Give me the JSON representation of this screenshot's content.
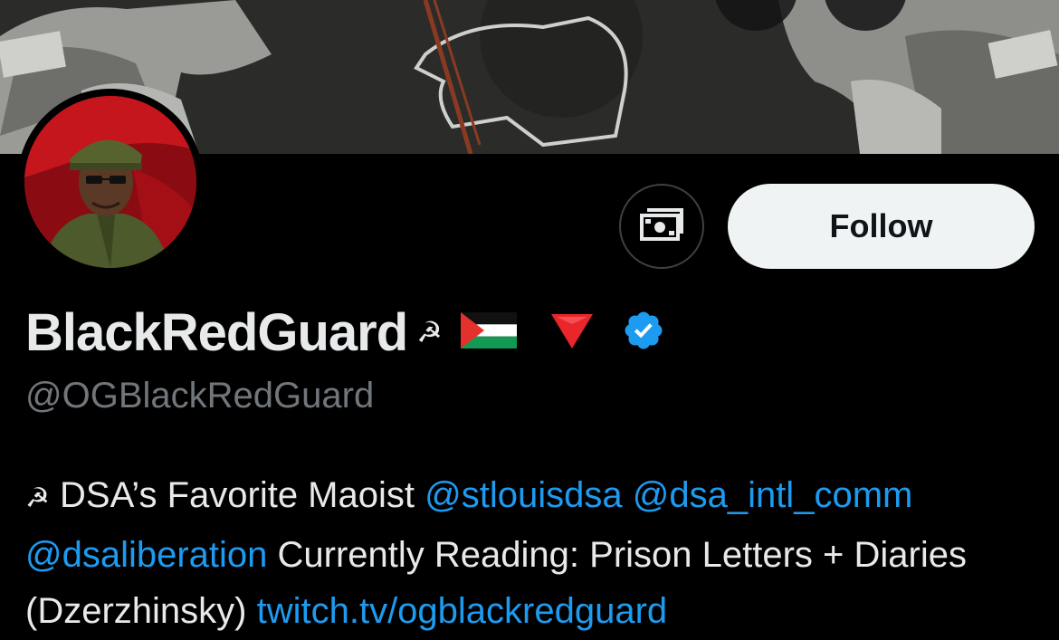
{
  "profile": {
    "display_name": "BlackRedGuard",
    "name_emojis": [
      "hammer-and-sickle",
      "palestine-flag",
      "red-down-triangle"
    ],
    "name_hs_glyph": "☭",
    "handle": "@OGBlackRedGuard",
    "verified": true
  },
  "actions": {
    "follow_label": "Follow",
    "tip_icon": "money-icon"
  },
  "bio": {
    "hs_glyph": "☭",
    "text1": " DSA’s Favorite Maoist ",
    "mention1": "@stlouisdsa",
    "space1": " ",
    "mention2": "@dsa_intl_comm",
    "mention3": "@dsaliberation",
    "text2": " Currently Reading: Prison Letters + Diaries (Dzerzhinsky) ",
    "link": "twitch.tv/ogblackredguard"
  },
  "colors": {
    "background": "#000000",
    "link": "#1d9bf0",
    "handle": "#71767b",
    "text": "#e7e9ea",
    "follow_bg": "#eff3f4",
    "verified": "#1d9bf0"
  }
}
